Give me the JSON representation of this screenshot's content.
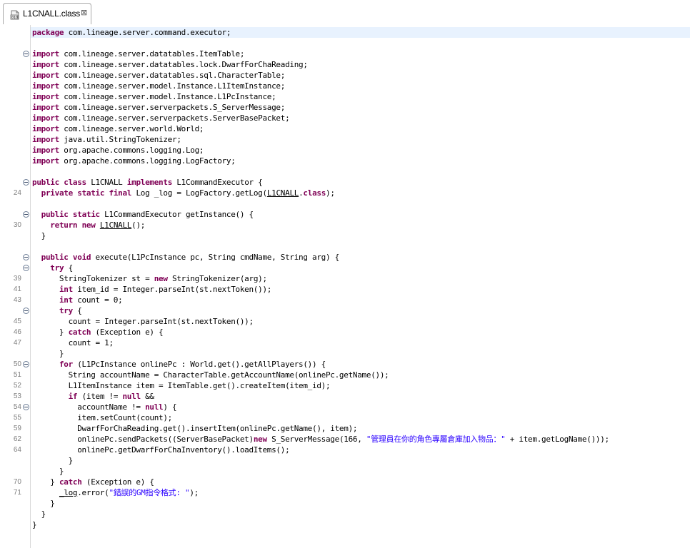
{
  "tab": {
    "label": "L1CNALL.class",
    "close": "⊠"
  },
  "colors": {
    "keyword": "#7f0055",
    "string": "#2a00ff",
    "line_number": "#808080",
    "current_line": "#e8f2fe"
  },
  "lines": [
    {
      "n": "",
      "fold": false,
      "segs": [
        [
          "k",
          "package"
        ],
        [
          "t",
          " com.lineage.server.command.executor;"
        ]
      ]
    },
    {
      "n": "",
      "fold": false,
      "segs": []
    },
    {
      "n": "",
      "fold": true,
      "segs": [
        [
          "k",
          "import"
        ],
        [
          "t",
          " com.lineage.server.datatables.ItemTable;"
        ]
      ]
    },
    {
      "n": "",
      "fold": false,
      "segs": [
        [
          "k",
          "import"
        ],
        [
          "t",
          " com.lineage.server.datatables.lock.DwarfForChaReading;"
        ]
      ]
    },
    {
      "n": "",
      "fold": false,
      "segs": [
        [
          "k",
          "import"
        ],
        [
          "t",
          " com.lineage.server.datatables.sql.CharacterTable;"
        ]
      ]
    },
    {
      "n": "",
      "fold": false,
      "segs": [
        [
          "k",
          "import"
        ],
        [
          "t",
          " com.lineage.server.model.Instance.L1ItemInstance;"
        ]
      ]
    },
    {
      "n": "",
      "fold": false,
      "segs": [
        [
          "k",
          "import"
        ],
        [
          "t",
          " com.lineage.server.model.Instance.L1PcInstance;"
        ]
      ]
    },
    {
      "n": "",
      "fold": false,
      "segs": [
        [
          "k",
          "import"
        ],
        [
          "t",
          " com.lineage.server.serverpackets.S_ServerMessage;"
        ]
      ]
    },
    {
      "n": "",
      "fold": false,
      "segs": [
        [
          "k",
          "import"
        ],
        [
          "t",
          " com.lineage.server.serverpackets.ServerBasePacket;"
        ]
      ]
    },
    {
      "n": "",
      "fold": false,
      "segs": [
        [
          "k",
          "import"
        ],
        [
          "t",
          " com.lineage.server.world.World;"
        ]
      ]
    },
    {
      "n": "",
      "fold": false,
      "segs": [
        [
          "k",
          "import"
        ],
        [
          "t",
          " java.util.StringTokenizer;"
        ]
      ]
    },
    {
      "n": "",
      "fold": false,
      "segs": [
        [
          "k",
          "import"
        ],
        [
          "t",
          " org.apache.commons.logging.Log;"
        ]
      ]
    },
    {
      "n": "",
      "fold": false,
      "segs": [
        [
          "k",
          "import"
        ],
        [
          "t",
          " org.apache.commons.logging.LogFactory;"
        ]
      ]
    },
    {
      "n": "",
      "fold": false,
      "segs": []
    },
    {
      "n": "",
      "fold": true,
      "segs": [
        [
          "k",
          "public"
        ],
        [
          "t",
          " "
        ],
        [
          "k",
          "class"
        ],
        [
          "t",
          " L1CNALL "
        ],
        [
          "k",
          "implements"
        ],
        [
          "t",
          " L1CommandExecutor {"
        ]
      ]
    },
    {
      "n": "24",
      "fold": false,
      "segs": [
        [
          "t",
          "  "
        ],
        [
          "k",
          "private"
        ],
        [
          "t",
          " "
        ],
        [
          "k",
          "static"
        ],
        [
          "t",
          " "
        ],
        [
          "k",
          "final"
        ],
        [
          "t",
          " Log _log = LogFactory.getLog("
        ],
        [
          "u",
          "L1CNALL"
        ],
        [
          "t",
          "."
        ],
        [
          "k",
          "class"
        ],
        [
          "t",
          ");"
        ]
      ]
    },
    {
      "n": "",
      "fold": false,
      "segs": []
    },
    {
      "n": "",
      "fold": true,
      "segs": [
        [
          "t",
          "  "
        ],
        [
          "k",
          "public"
        ],
        [
          "t",
          " "
        ],
        [
          "k",
          "static"
        ],
        [
          "t",
          " L1CommandExecutor getInstance() {"
        ]
      ]
    },
    {
      "n": "30",
      "fold": false,
      "segs": [
        [
          "t",
          "    "
        ],
        [
          "k",
          "return"
        ],
        [
          "t",
          " "
        ],
        [
          "k",
          "new"
        ],
        [
          "t",
          " "
        ],
        [
          "u",
          "L1CNALL"
        ],
        [
          "t",
          "();"
        ]
      ]
    },
    {
      "n": "",
      "fold": false,
      "segs": [
        [
          "t",
          "  }"
        ]
      ]
    },
    {
      "n": "",
      "fold": false,
      "segs": []
    },
    {
      "n": "",
      "fold": true,
      "segs": [
        [
          "t",
          "  "
        ],
        [
          "k",
          "public"
        ],
        [
          "t",
          " "
        ],
        [
          "k",
          "void"
        ],
        [
          "t",
          " execute(L1PcInstance pc, String cmdName, String arg) {"
        ]
      ]
    },
    {
      "n": "",
      "fold": true,
      "segs": [
        [
          "t",
          "    "
        ],
        [
          "k",
          "try"
        ],
        [
          "t",
          " {"
        ]
      ]
    },
    {
      "n": "39",
      "fold": false,
      "segs": [
        [
          "t",
          "      StringTokenizer st = "
        ],
        [
          "k",
          "new"
        ],
        [
          "t",
          " StringTokenizer(arg);"
        ]
      ]
    },
    {
      "n": "41",
      "fold": false,
      "segs": [
        [
          "t",
          "      "
        ],
        [
          "k",
          "int"
        ],
        [
          "t",
          " item_id = Integer.parseInt(st.nextToken());"
        ]
      ]
    },
    {
      "n": "43",
      "fold": false,
      "segs": [
        [
          "t",
          "      "
        ],
        [
          "k",
          "int"
        ],
        [
          "t",
          " count = 0;"
        ]
      ]
    },
    {
      "n": "",
      "fold": true,
      "segs": [
        [
          "t",
          "      "
        ],
        [
          "k",
          "try"
        ],
        [
          "t",
          " {"
        ]
      ]
    },
    {
      "n": "45",
      "fold": false,
      "segs": [
        [
          "t",
          "        count = Integer.parseInt(st.nextToken());"
        ]
      ]
    },
    {
      "n": "46",
      "fold": false,
      "segs": [
        [
          "t",
          "      } "
        ],
        [
          "k",
          "catch"
        ],
        [
          "t",
          " (Exception e) {"
        ]
      ]
    },
    {
      "n": "47",
      "fold": false,
      "segs": [
        [
          "t",
          "        count = 1;"
        ]
      ]
    },
    {
      "n": "",
      "fold": false,
      "segs": [
        [
          "t",
          "      }"
        ]
      ]
    },
    {
      "n": "50",
      "fold": true,
      "segs": [
        [
          "t",
          "      "
        ],
        [
          "k",
          "for"
        ],
        [
          "t",
          " (L1PcInstance onlinePc : World.get().getAllPlayers()) {"
        ]
      ]
    },
    {
      "n": "51",
      "fold": false,
      "segs": [
        [
          "t",
          "        String accountName = CharacterTable.getAccountName(onlinePc.getName());"
        ]
      ]
    },
    {
      "n": "52",
      "fold": false,
      "segs": [
        [
          "t",
          "        L1ItemInstance item = ItemTable.get().createItem(item_id);"
        ]
      ]
    },
    {
      "n": "53",
      "fold": false,
      "segs": [
        [
          "t",
          "        "
        ],
        [
          "k",
          "if"
        ],
        [
          "t",
          " (item != "
        ],
        [
          "k",
          "null"
        ],
        [
          "t",
          " &&"
        ]
      ]
    },
    {
      "n": "54",
      "fold": true,
      "segs": [
        [
          "t",
          "          accountName != "
        ],
        [
          "k",
          "null"
        ],
        [
          "t",
          ") {"
        ]
      ]
    },
    {
      "n": "55",
      "fold": false,
      "segs": [
        [
          "t",
          "          item.setCount(count);"
        ]
      ]
    },
    {
      "n": "59",
      "fold": false,
      "segs": [
        [
          "t",
          "          DwarfForChaReading.get().insertItem(onlinePc.getName(), item);"
        ]
      ]
    },
    {
      "n": "62",
      "fold": false,
      "segs": [
        [
          "t",
          "          onlinePc.sendPackets((ServerBasePacket)"
        ],
        [
          "k",
          "new"
        ],
        [
          "t",
          " S_ServerMessage(166, "
        ],
        [
          "s",
          "\"管理員在你的角色專屬倉庫加入物品：\""
        ],
        [
          "t",
          " + item.getLogName()));"
        ]
      ]
    },
    {
      "n": "64",
      "fold": false,
      "segs": [
        [
          "t",
          "          onlinePc.getDwarfForChaInventory().loadItems();"
        ]
      ]
    },
    {
      "n": "",
      "fold": false,
      "segs": [
        [
          "t",
          "        }"
        ]
      ]
    },
    {
      "n": "",
      "fold": false,
      "segs": [
        [
          "t",
          "      }"
        ]
      ]
    },
    {
      "n": "70",
      "fold": false,
      "segs": [
        [
          "t",
          "    } "
        ],
        [
          "k",
          "catch"
        ],
        [
          "t",
          " (Exception e) {"
        ]
      ]
    },
    {
      "n": "71",
      "fold": false,
      "segs": [
        [
          "t",
          "      "
        ],
        [
          "u",
          "_log"
        ],
        [
          "t",
          ".error("
        ],
        [
          "s",
          "\"錯誤的GM指令格式: \""
        ],
        [
          "t",
          ");"
        ]
      ]
    },
    {
      "n": "",
      "fold": false,
      "segs": [
        [
          "t",
          "    }"
        ]
      ]
    },
    {
      "n": "",
      "fold": false,
      "segs": [
        [
          "t",
          "  }"
        ]
      ]
    },
    {
      "n": "",
      "fold": false,
      "segs": [
        [
          "t",
          "}"
        ]
      ]
    }
  ]
}
